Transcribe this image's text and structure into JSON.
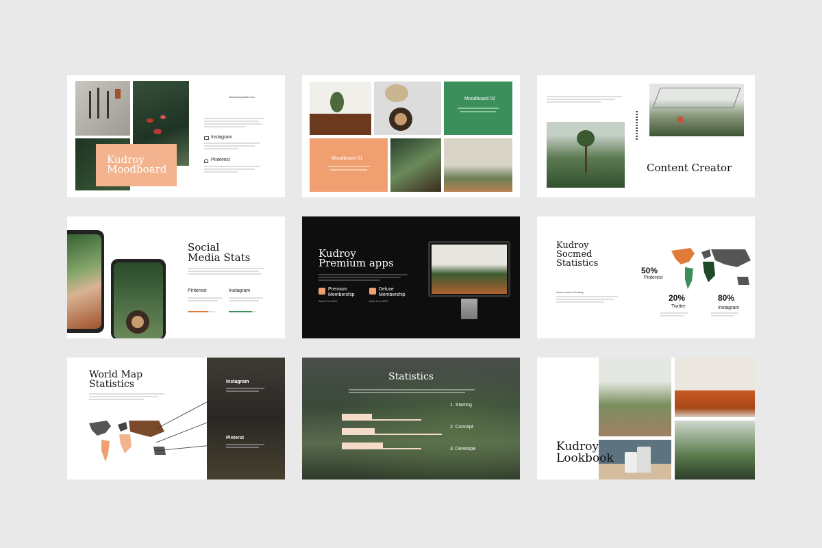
{
  "slide1": {
    "title_line1": "Kudroy",
    "title_line2": "Moodboard",
    "url": "www.kudroystudios.com",
    "instagram": "Instagram",
    "pinterest": "Pinterest"
  },
  "slide2": {
    "moodboard02": "Moodboard 02",
    "moodboard01": "Moodboard 01"
  },
  "slide3": {
    "title": "Content Creator"
  },
  "slide4": {
    "title_line1": "Social",
    "title_line2": "Media Stats",
    "pinterest": "Pinterest",
    "instagram": "Instagram"
  },
  "slide5": {
    "title_line1": "Kudroy",
    "title_line2": "Premium apps",
    "premium_line1": "Premium",
    "premium_line2": "Membership",
    "deluxe_line1": "Deluxe",
    "deluxe_line2": "Membership",
    "premium_price": "Starts From $100",
    "deluxe_price": "Starts From $200"
  },
  "slide6": {
    "title_line1": "Kudroy",
    "title_line2": "Socmed",
    "title_line3": "Statistics",
    "subtitle": "a few words of Kudroy",
    "stat1_value": "50%",
    "stat1_label": "Pinterest",
    "stat2_value": "20%",
    "stat2_label": "Twitter",
    "stat3_value": "80%",
    "stat3_label": "Instagram"
  },
  "slide7": {
    "title_line1": "World Map",
    "title_line2": "Statistics",
    "instagram": "Instagram",
    "pinterest": "Pinterst"
  },
  "slide8": {
    "title": "Statistics",
    "step1": "1. Starting",
    "step2": "2. Concept",
    "step3": "3. Develope"
  },
  "slide9": {
    "title_line1": "Kudroy",
    "title_line2": "Lookbook"
  },
  "colors": {
    "orange": "#f0a070",
    "peach": "#f2b38e",
    "green": "#3a8f5a",
    "dark": "#0e0e0e",
    "brown": "#7a4a2a"
  }
}
